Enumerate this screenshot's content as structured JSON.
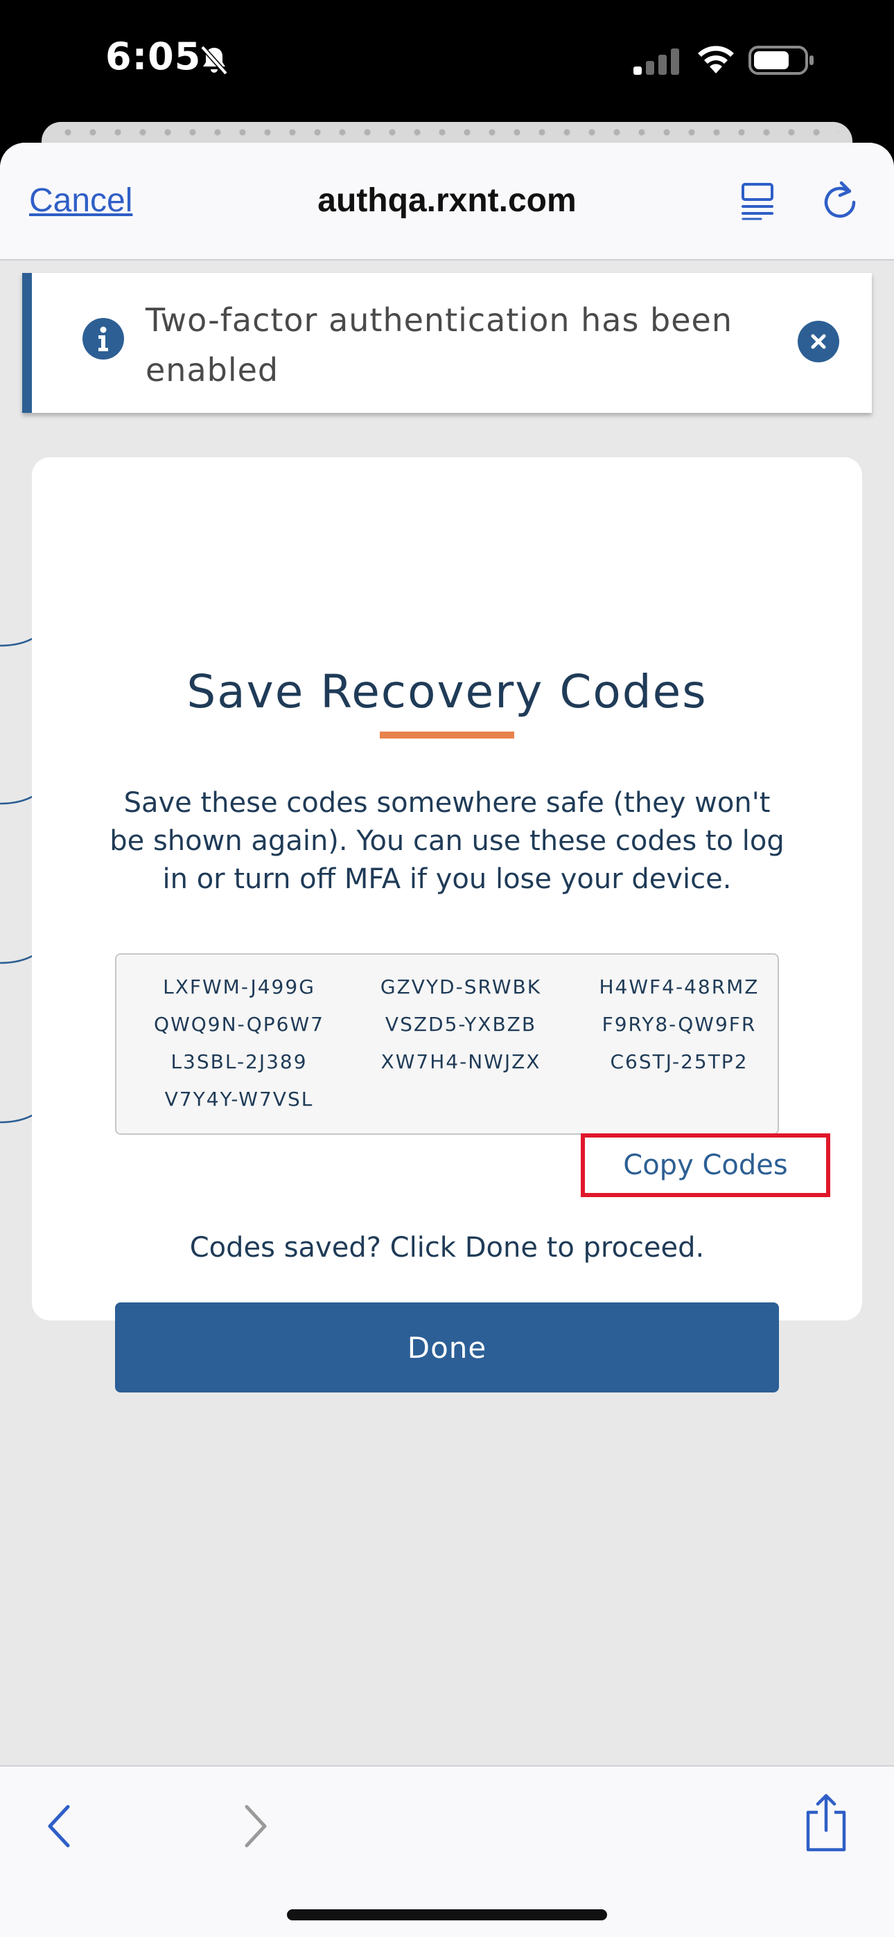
{
  "status_bar": {
    "time": "6:05",
    "icons": [
      "bell-slash-icon",
      "cellular-signal-icon",
      "wifi-icon",
      "battery-icon"
    ]
  },
  "browser": {
    "cancel_label": "Cancel",
    "url": "authqa.rxnt.com",
    "icons": [
      "reader-mode-icon",
      "reload-icon"
    ]
  },
  "alert": {
    "message": "Two-factor authentication has been enabled",
    "icons": [
      "info-icon",
      "close-icon"
    ],
    "accent_color": "#2d5f94"
  },
  "recovery": {
    "title": "Save Recovery Codes",
    "description": "Save these codes somewhere safe (they won't be shown again). You can use these codes to log in or turn off MFA if you lose your device.",
    "codes": [
      "LXFWM-J499G",
      "GZVYD-SRWBK",
      "H4WF4-48RMZ",
      "QWQ9N-QP6W7",
      "VSZD5-YXBZB",
      "F9RY8-QW9FR",
      "L3SBL-2J389",
      "XW7H4-NWJZX",
      "C6STJ-25TP2",
      "V7Y4Y-W7VSL"
    ],
    "copy_label": "Copy Codes",
    "saved_note": "Codes saved? Click Done to proceed.",
    "done_label": "Done",
    "title_color": "#1f3b57",
    "underline_color": "#e8824c",
    "button_color": "#2b5f96",
    "highlight_color": "#e0172a"
  },
  "toolbar": {
    "icons": [
      "back-arrow-icon",
      "forward-arrow-icon",
      "share-icon"
    ]
  }
}
